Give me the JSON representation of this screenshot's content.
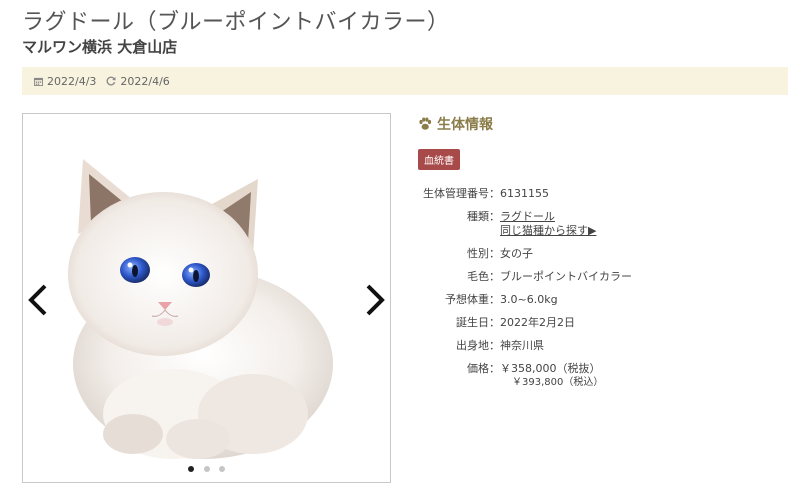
{
  "header": {
    "title": "ラグドール（ブルーポイントバイカラー）",
    "shop": "マルワン横浜 大倉山店"
  },
  "dates": {
    "posted": "2022/4/3",
    "updated": "2022/4/6"
  },
  "gallery": {
    "slide_count": 3,
    "active_index": 0
  },
  "info": {
    "section_title": "生体情報",
    "badge": "血統書",
    "rows": [
      {
        "label": "生体管理番号：",
        "value": "6131155"
      },
      {
        "label": "種類：",
        "value": "ラグドール",
        "link2": "同じ猫種から探す▶"
      },
      {
        "label": "性別：",
        "value": "女の子"
      },
      {
        "label": "毛色：",
        "value": "ブルーポイントバイカラー"
      },
      {
        "label": "予想体重：",
        "value": "3.0~6.0kg"
      },
      {
        "label": "誕生日：",
        "value": "2022年2月2日"
      },
      {
        "label": "出身地：",
        "value": "神奈川県"
      },
      {
        "label": "価格：",
        "value": "￥358,000（税抜）",
        "value2": "￥393,800（税込）"
      }
    ]
  },
  "colors": {
    "accent": "#8a7d4a",
    "badge_bg": "#a94a4a",
    "datebar_bg": "#f7f3df"
  }
}
